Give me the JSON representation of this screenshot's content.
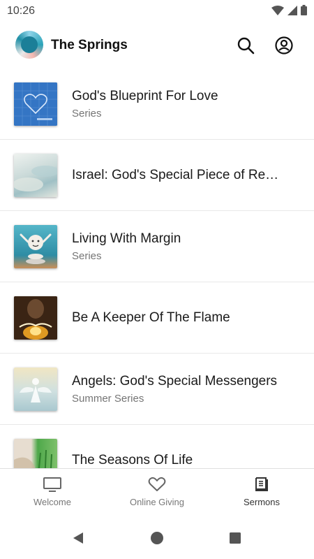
{
  "status_bar": {
    "time": "10:26",
    "icons": [
      "wifi-icon",
      "cell-signal-icon",
      "battery-icon"
    ]
  },
  "app_bar": {
    "title": "The Springs",
    "actions": [
      "search-icon",
      "account-icon"
    ]
  },
  "sermons": [
    {
      "title": "God's Blueprint For Love",
      "subtitle": "Series"
    },
    {
      "title": "Israel: God's Special Piece of Re…",
      "subtitle": ""
    },
    {
      "title": "Living With Margin",
      "subtitle": "Series"
    },
    {
      "title": "Be A Keeper Of The Flame",
      "subtitle": ""
    },
    {
      "title": "Angels: God's Special Messengers",
      "subtitle": "Summer Series"
    },
    {
      "title": "The Seasons Of Life",
      "subtitle": ""
    }
  ],
  "bottom_nav": {
    "tabs": [
      {
        "label": "Welcome",
        "icon": "tv-icon"
      },
      {
        "label": "Online Giving",
        "icon": "heart-icon"
      },
      {
        "label": "Sermons",
        "icon": "book-icon"
      }
    ],
    "active": "Sermons"
  },
  "system_nav": [
    "back-icon",
    "home-icon",
    "recents-icon"
  ],
  "colors": {
    "background": "#ffffff",
    "title_text": "#1a1a1a",
    "subtitle_text": "#757575",
    "divider": "#e8e8e8"
  }
}
